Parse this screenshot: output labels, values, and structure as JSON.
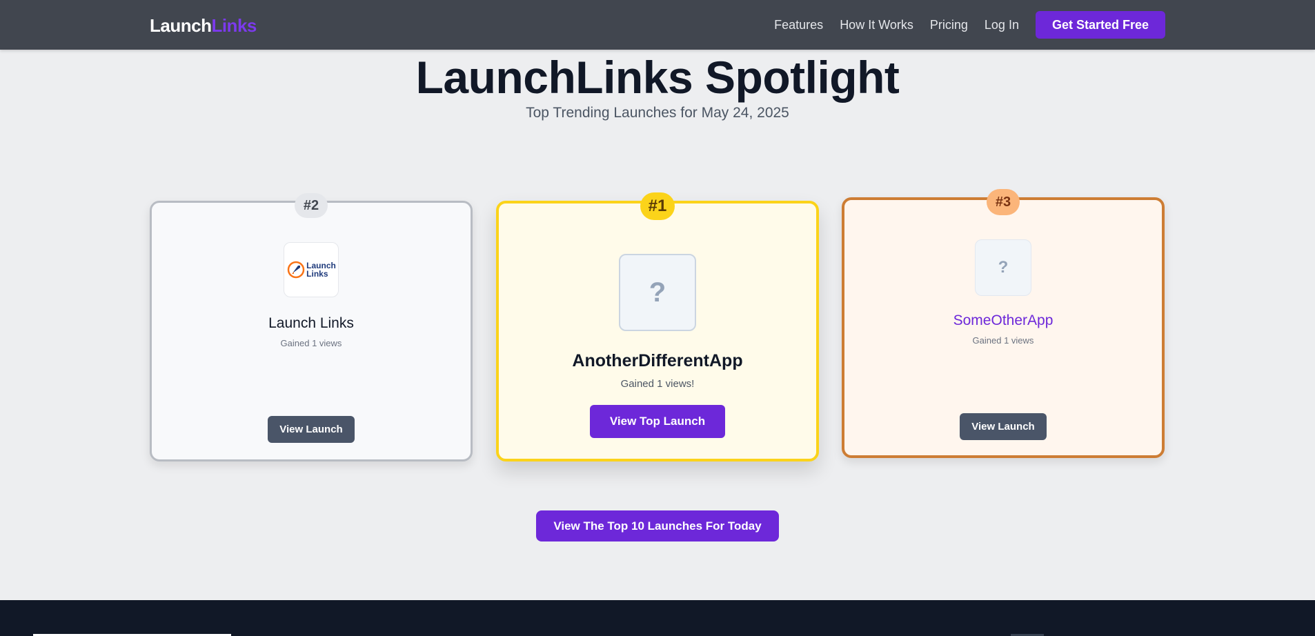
{
  "header": {
    "logo_part1": "Launch",
    "logo_part2": "Links",
    "nav": [
      "Features",
      "How It Works",
      "Pricing",
      "Log In"
    ],
    "cta": "Get Started Free"
  },
  "hero": {
    "title": "LaunchLinks Spotlight",
    "subtitle": "Top Trending Launches for May 24, 2025"
  },
  "cards": {
    "second": {
      "rank": "#2",
      "logo_text_line1": "Launch",
      "logo_text_line2": "Links",
      "name": "Launch Links",
      "views": "Gained 1 views",
      "button": "View Launch"
    },
    "first": {
      "rank": "#1",
      "logo_placeholder": "?",
      "name": "AnotherDifferentApp",
      "views": "Gained 1 views!",
      "button": "View Top Launch"
    },
    "third": {
      "rank": "#3",
      "logo_placeholder": "?",
      "name": "SomeOtherApp",
      "views": "Gained 1 views",
      "button": "View Launch"
    }
  },
  "top10_button": "View The Top 10 Launches For Today",
  "colors": {
    "accent": "#6d28d9",
    "gold": "#fbd31a",
    "silver": "#b8bcc3",
    "bronze": "#cd7d34",
    "header_bg": "#41464f",
    "footer_bg": "#111827"
  }
}
